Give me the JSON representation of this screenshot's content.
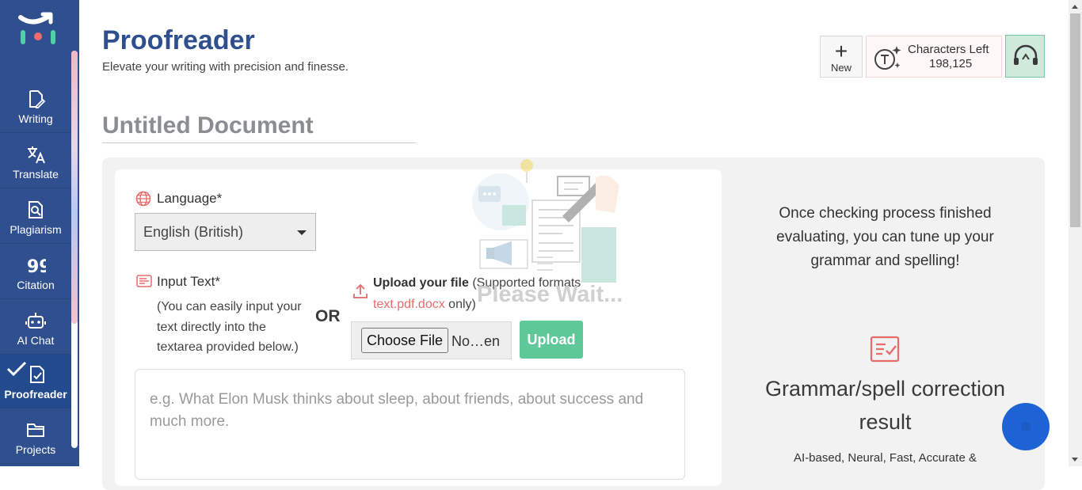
{
  "sidebar": {
    "items": [
      {
        "label": "Writing",
        "icon": "edit-document-icon"
      },
      {
        "label": "Translate",
        "icon": "translate-icon"
      },
      {
        "label": "Plagiarism",
        "icon": "plagiarism-icon"
      },
      {
        "label": "Citation",
        "icon": "quote-icon"
      },
      {
        "label": "AI Chat",
        "icon": "robot-icon"
      },
      {
        "label": "Proofreader",
        "icon": "proofread-icon",
        "active": true
      },
      {
        "label": "Projects",
        "icon": "folder-icon"
      }
    ]
  },
  "header": {
    "title": "Proofreader",
    "subtitle": "Elevate your writing with precision and finesse.",
    "new_label": "New",
    "chars_left_label": "Characters Left",
    "chars_left_value": "198,125"
  },
  "document": {
    "title": "Untitled Document"
  },
  "form": {
    "language_label": "Language*",
    "language_value": "English (British)",
    "input_label": "Input Text*",
    "input_hint": "(You can easily input your text directly into the textarea provided below.)",
    "or_label": "OR",
    "upload_title": "Upload your file",
    "upload_supported_pre": " (Supported formats ",
    "upload_formats": "text.pdf.docx",
    "upload_supported_post": " only)",
    "choose_file_label": "Choose File",
    "no_file_label": "No…en",
    "upload_button": "Upload",
    "textarea_placeholder": "e.g. What Elon Musk thinks about sleep, about friends, about success and much more."
  },
  "loading": {
    "text": "Please Wait..."
  },
  "info": {
    "message": "Once checking process finished evaluating, you can tune up your grammar and spelling!",
    "result_title": "Grammar/spell correction result",
    "result_subtitle": "AI-based, Neural, Fast, Accurate &"
  },
  "colors": {
    "sidebar": "#2f4f8f",
    "title": "#2f4f8f",
    "accent_red": "#e66b6b",
    "upload_green": "#5ec898",
    "chat_blue": "#1e63d6"
  }
}
